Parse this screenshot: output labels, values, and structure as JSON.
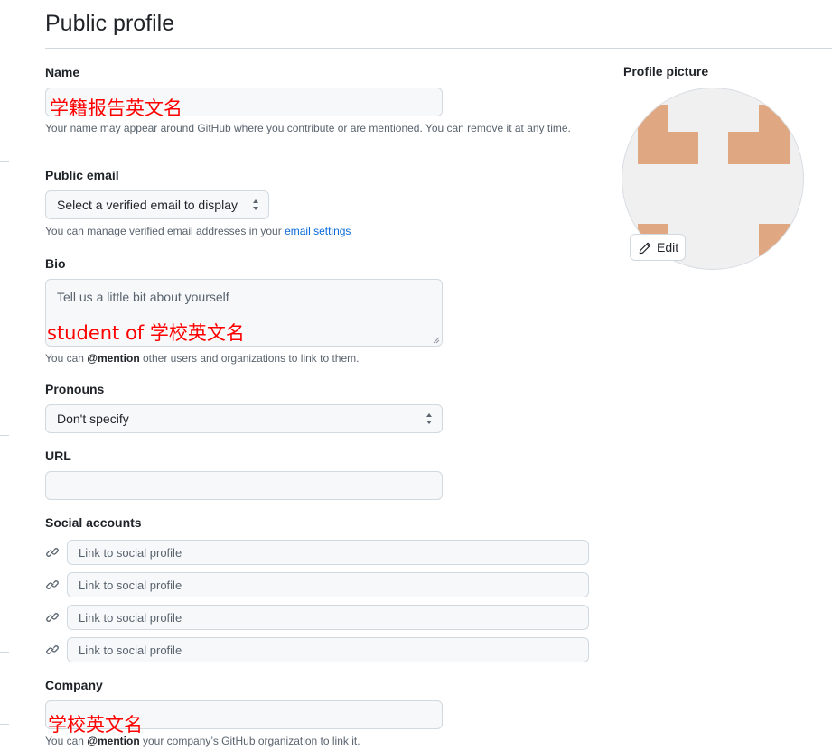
{
  "page": {
    "title": "Public profile"
  },
  "name": {
    "label": "Name",
    "value": "学籍报告英文名",
    "note": "Your name may appear around GitHub where you contribute or are mentioned. You can remove it at any time."
  },
  "public_email": {
    "label": "Public email",
    "selected": "Select a verified email to display",
    "note_prefix": "You can manage verified email addresses in your",
    "note_link": "email settings"
  },
  "bio": {
    "label": "Bio",
    "placeholder": "Tell us a little bit about yourself",
    "value": "student of 学校英文名",
    "note_prefix": "You can",
    "note_mention": "@mention",
    "note_suffix": "other users and organizations to link to them."
  },
  "pronouns": {
    "label": "Pronouns",
    "selected": "Don't specify"
  },
  "url": {
    "label": "URL",
    "value": ""
  },
  "social": {
    "label": "Social accounts",
    "placeholders": [
      "Link to social profile",
      "Link to social profile",
      "Link to social profile",
      "Link to social profile"
    ],
    "icon": "link-icon"
  },
  "company": {
    "label": "Company",
    "value": "学校英文名",
    "note_prefix": "You can",
    "note_mention": "@mention",
    "note_suffix": "your company’s GitHub organization to link it."
  },
  "profile_picture": {
    "label": "Profile picture",
    "edit_label": "Edit",
    "edit_icon": "pencil-icon",
    "accent": "#e0a882"
  },
  "colors": {
    "link": "#0969da",
    "overlay_text": "#ff0000",
    "field_bg": "#f6f8fa",
    "border": "#d1d9e0"
  }
}
